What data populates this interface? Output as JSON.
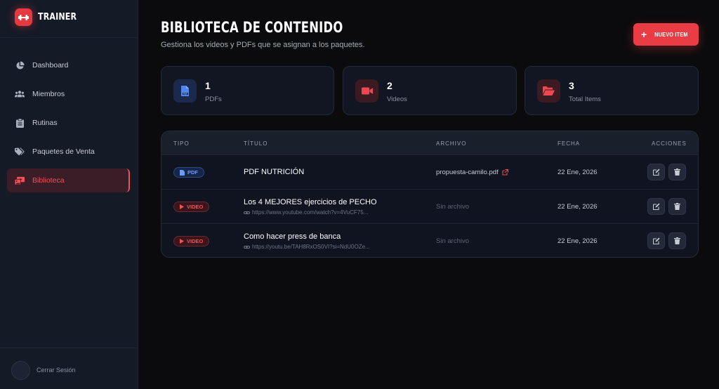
{
  "brand": {
    "name": "TRAINER"
  },
  "sidebar": {
    "items": [
      {
        "label": "Dashboard",
        "icon": "pie-chart-icon"
      },
      {
        "label": "Miembros",
        "icon": "users-icon"
      },
      {
        "label": "Rutinas",
        "icon": "clipboard-icon"
      },
      {
        "label": "Paquetes de Venta",
        "icon": "tags-icon"
      },
      {
        "label": "Biblioteca",
        "icon": "photo-video-icon",
        "active": true
      }
    ],
    "logout_label": "Cerrar Sesión"
  },
  "header": {
    "title": "BIBLIOTECA DE CONTENIDO",
    "subtitle": "Gestiona los videos y PDFs que se asignan a los paquetes.",
    "new_button": "NUEVO ITEM"
  },
  "stats": [
    {
      "value": "1",
      "label": "PDFs",
      "icon": "file-pdf-icon"
    },
    {
      "value": "2",
      "label": "Videos",
      "icon": "video-icon"
    },
    {
      "value": "3",
      "label": "Total Items",
      "icon": "folder-open-icon"
    }
  ],
  "table": {
    "columns": {
      "tipo": "TIPO",
      "titulo": "TÍTULO",
      "archivo": "ARCHIVO",
      "fecha": "FECHA",
      "acciones": "ACCIONES"
    },
    "rows": [
      {
        "type": "PDF",
        "title": "PDF NUTRICIÓN",
        "url": "",
        "file": "propuesta-camilo.pdf",
        "date": "22 Ene, 2026"
      },
      {
        "type": "VIDEO",
        "title": "Los 4 MEJORES ejercicios de PECHO",
        "url": "https://www.youtube.com/watch?v=4VuCF75...",
        "file": "Sin archivo",
        "date": "22 Ene, 2026"
      },
      {
        "type": "VIDEO",
        "title": "Como hacer press de banca",
        "url": "https://youtu.be/TAH8RxOS0VI?si=NdU0OZe...",
        "file": "Sin archivo",
        "date": "22 Ene, 2026"
      }
    ]
  },
  "colors": {
    "accent": "#ea3c44",
    "pdf": "#6e9bf2",
    "background": "#0b0b0d",
    "sidebar": "#151a27"
  }
}
